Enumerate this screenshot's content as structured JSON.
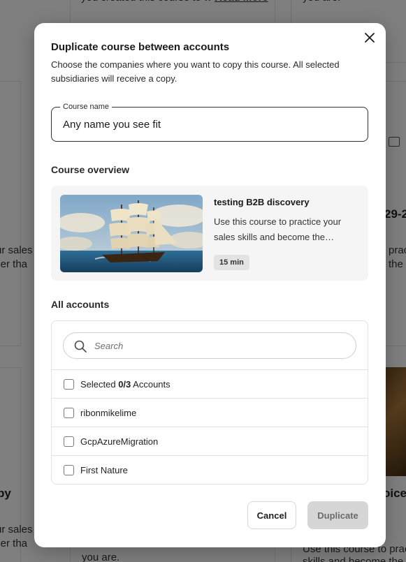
{
  "background": {
    "top_link_fragment": "you created this course to w Read More",
    "top_right_fragment": "you are.",
    "left_fragment_1": "ur sales",
    "left_fragment_2": "ller tha",
    "left_bold_fragment": "py",
    "left_fragment_3": "ur sales",
    "left_fragment_4": "ller tha",
    "right_bold_fragment": "29-2",
    "right_fragment_1": "prac",
    "right_fragment_2": "the",
    "right_bold_fragment_2": "oice",
    "bottom_middle_fragment": "you are.",
    "bottom_right_fragment_1": "Use this course to practice",
    "bottom_right_fragment_2": "skills and become the"
  },
  "modal": {
    "title": "Duplicate course between accounts",
    "description": "Choose the companies where you want to copy this course. All selected subsidiaries will receive a copy.",
    "close_icon": "close-icon",
    "course_name": {
      "label": "Course name",
      "value": "Any name you see fit"
    },
    "overview": {
      "heading": "Course overview",
      "course_title": "testing B2B discovery",
      "course_description": "Use this course to practice your sales skills and become the greatest sales person in the world.",
      "duration": "15 min",
      "image_alt": "sailing-ship-painting"
    },
    "accounts": {
      "heading": "All accounts",
      "search_placeholder": "Search",
      "select_all_prefix": "Selected ",
      "selected_count": "0/3",
      "select_all_suffix": " Accounts",
      "items": [
        {
          "label": "ribonmikelime",
          "checked": false
        },
        {
          "label": "GcpAzureMigration",
          "checked": false
        },
        {
          "label": "First Nature",
          "checked": false
        }
      ]
    },
    "buttons": {
      "cancel": "Cancel",
      "duplicate": "Duplicate"
    }
  },
  "colors": {
    "overlay": "#000000",
    "primary_text": "#1a1a1a",
    "disabled_button": "#d6d6d6"
  }
}
